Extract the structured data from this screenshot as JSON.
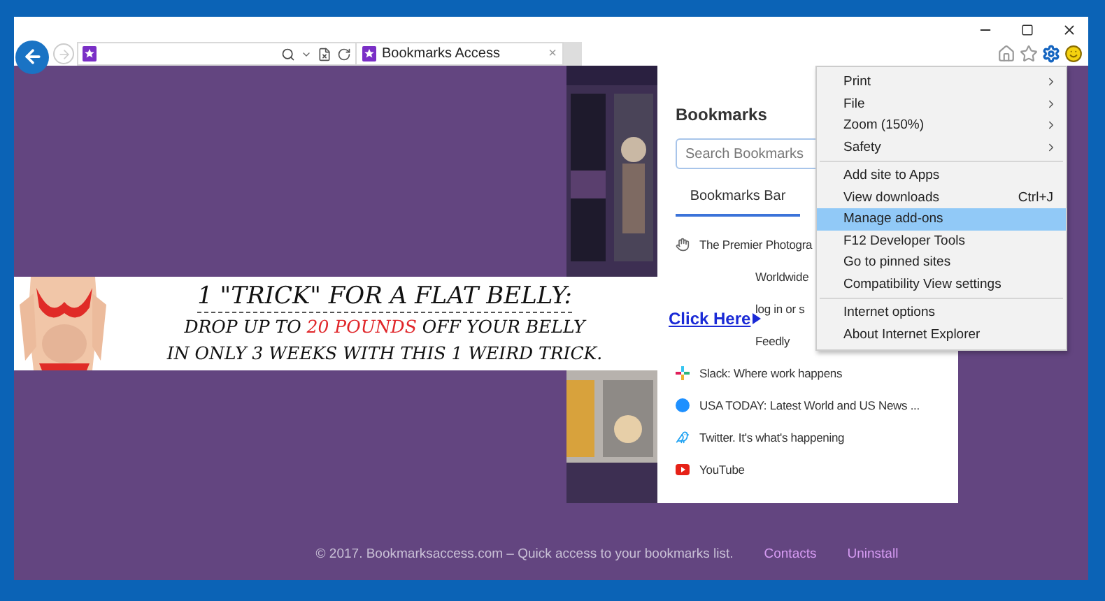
{
  "browser": {
    "tab": {
      "title": "Bookmarks Access",
      "close": "×"
    }
  },
  "bookmarks_panel": {
    "title": "Bookmarks",
    "search": {
      "placeholder": "Search Bookmarks"
    },
    "tab": {
      "label": "Bookmarks Bar",
      "selected": true
    },
    "items": [
      {
        "label": "The Premier Photogra"
      },
      {
        "kind": "hidden",
        "label": "Worldwide"
      },
      {
        "kind": "hidden",
        "label": "log in or s"
      },
      {
        "kind": "hidden",
        "label": "Feedly"
      },
      {
        "kind": "slack",
        "label": "Slack: Where work happens"
      },
      {
        "kind": "circle",
        "label": "USA TODAY: Latest World and US News ..."
      },
      {
        "kind": "twitter",
        "label": "Twitter. It's what's happening"
      },
      {
        "kind": "youtube",
        "label": "YouTube"
      }
    ]
  },
  "ad_banner": {
    "headline": "1 \"TRICK\" FOR A FLAT BELLY:",
    "line_2": {
      "before": "DROP UP TO ",
      "highlight": "20 POUNDS",
      "after": " OFF YOUR BELLY"
    },
    "line_3": "IN ONLY 3 WEEKS WITH THIS 1 WEIRD TRICK.",
    "link": "Click Here"
  },
  "tools_menu": {
    "sections": [
      [
        {
          "label": "Print",
          "submenu": true,
          "selected": false
        },
        {
          "label": "File",
          "submenu": true,
          "selected": false
        },
        {
          "label": "Zoom (150%)",
          "submenu": true,
          "selected": false
        },
        {
          "label": "Safety",
          "submenu": true,
          "selected": false
        }
      ],
      [
        {
          "label": "Add site to Apps",
          "selected": false
        },
        {
          "label": "View downloads",
          "shortcut": "Ctrl+J",
          "selected": false
        },
        {
          "label": "Manage add-ons",
          "selected": true
        },
        {
          "label": "F12 Developer Tools",
          "selected": false
        },
        {
          "label": "Go to pinned sites",
          "selected": false
        },
        {
          "label": "Compatibility View settings",
          "selected": false
        }
      ],
      [
        {
          "label": "Internet options",
          "selected": false
        },
        {
          "label": "About Internet Explorer",
          "selected": false
        }
      ]
    ]
  },
  "footer": {
    "text": "© 2017. Bookmarksaccess.com – Quick access to your bookmarks list.",
    "links": [
      "Contacts",
      "Uninstall"
    ]
  }
}
